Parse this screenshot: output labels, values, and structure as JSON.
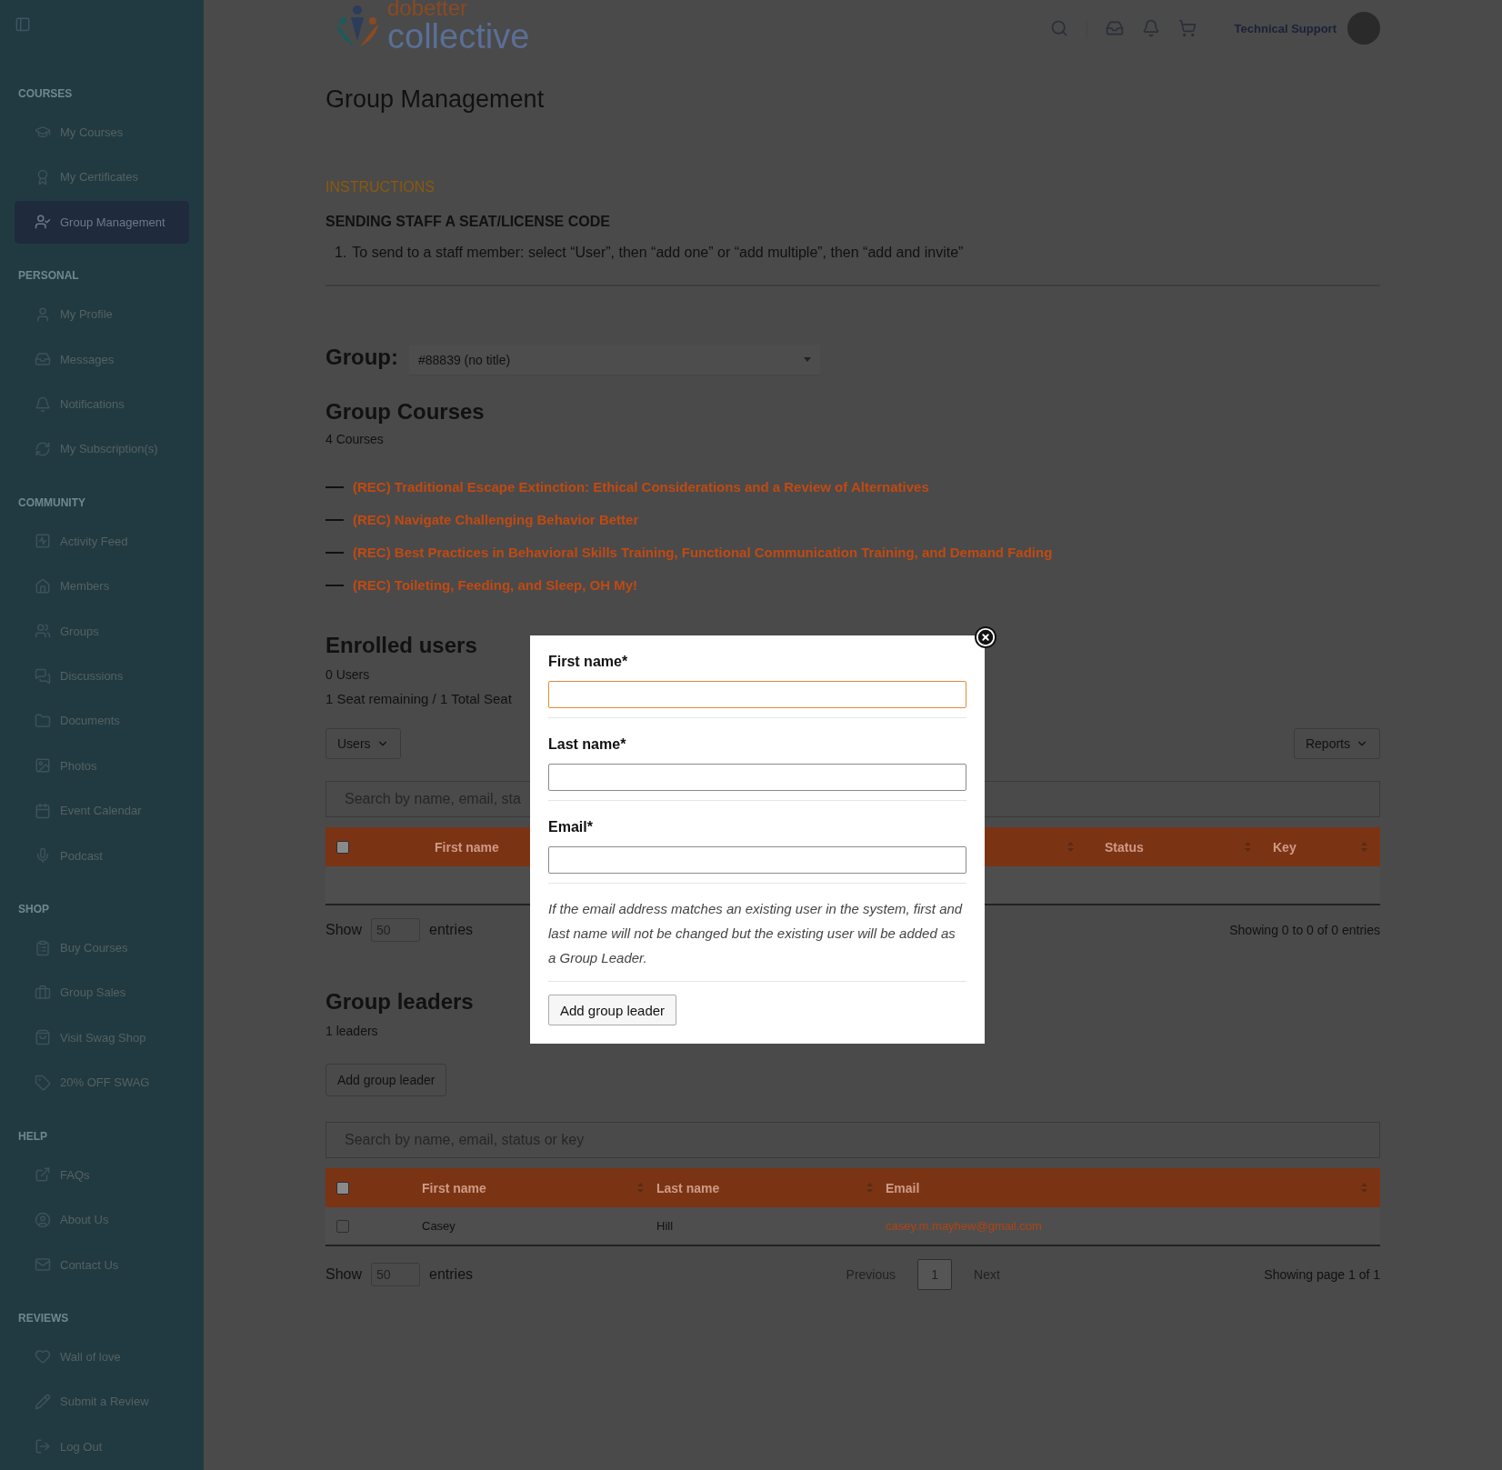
{
  "sidebar": {
    "sections": [
      {
        "heading": "COURSES",
        "items": [
          {
            "label": "My Courses",
            "selected": false
          },
          {
            "label": "My Certificates",
            "selected": false
          },
          {
            "label": "Group Management",
            "selected": true
          }
        ]
      },
      {
        "heading": "PERSONAL",
        "items": [
          {
            "label": "My Profile",
            "selected": false
          },
          {
            "label": "Messages",
            "selected": false
          },
          {
            "label": "Notifications",
            "selected": false
          },
          {
            "label": "My Subscription(s)",
            "selected": false
          }
        ]
      },
      {
        "heading": "COMMUNITY",
        "items": [
          {
            "label": "Activity Feed",
            "selected": false
          },
          {
            "label": "Members",
            "selected": false
          },
          {
            "label": "Groups",
            "selected": false
          },
          {
            "label": "Discussions",
            "selected": false
          },
          {
            "label": "Documents",
            "selected": false
          },
          {
            "label": "Photos",
            "selected": false
          },
          {
            "label": "Event Calendar",
            "selected": false
          },
          {
            "label": "Podcast",
            "selected": false
          }
        ]
      },
      {
        "heading": "SHOP",
        "items": [
          {
            "label": "Buy Courses",
            "selected": false
          },
          {
            "label": "Group Sales",
            "selected": false
          },
          {
            "label": "Visit Swag Shop",
            "selected": false
          },
          {
            "label": "20% OFF SWAG",
            "selected": false
          }
        ]
      },
      {
        "heading": "HELP",
        "items": [
          {
            "label": "FAQs",
            "selected": false
          },
          {
            "label": "About Us",
            "selected": false
          },
          {
            "label": "Contact Us",
            "selected": false
          }
        ]
      },
      {
        "heading": "REVIEWS",
        "items": [
          {
            "label": "Wall of love",
            "selected": false
          },
          {
            "label": "Submit a Review",
            "selected": false
          },
          {
            "label": "Log Out",
            "selected": false
          }
        ]
      }
    ]
  },
  "header": {
    "logo": {
      "top": "dobetter",
      "bottom": "collective"
    },
    "user": "Technical Support"
  },
  "page_title": "Group Management",
  "instructions": {
    "label": "INSTRUCTIONS",
    "heading": "SENDING STAFF A SEAT/LICENSE CODE",
    "steps": [
      {
        "number": "1.",
        "text": "To send to a staff member: select “User”, then “add one” or “add multiple”, then “add and invite”"
      }
    ]
  },
  "group": {
    "label": "Group:",
    "value": "#88839 (no title)"
  },
  "courses": {
    "title": "Group Courses",
    "count": "4 Courses",
    "items": [
      "(REC) Traditional Escape Extinction: Ethical Considerations and a Review of Alternatives",
      "(REC) Navigate Challenging Behavior Better",
      "(REC) Best Practices in Behavioral Skills Training, Functional Communication Training, and Demand Fading",
      "(REC) Toileting, Feeding, and Sleep, OH My!"
    ]
  },
  "enrolled": {
    "title": "Enrolled users",
    "count": "0 Users",
    "seats": "1 Seat remaining / 1 Total Seat",
    "users_menu": "Users",
    "reports_menu": "Reports",
    "search_placeholder": "Search by name, email, sta",
    "select_all_checked": false,
    "columns": [
      "First name",
      "Status",
      "Key"
    ],
    "show": "Show",
    "page_size": "50",
    "entries": "entries",
    "info": "Showing 0 to 0 of 0 entries"
  },
  "leaders": {
    "title": "Group leaders",
    "count": "1 leaders",
    "add_button": "Add group leader",
    "search_placeholder": "Search by name, email, status or key",
    "select_all_checked": false,
    "columns": [
      "First name",
      "Last name",
      "Email"
    ],
    "rows": [
      {
        "first": "Casey",
        "last": "Hill",
        "email": "casey.m.mayhew@gmail.com",
        "checked": false
      }
    ],
    "show": "Show",
    "page_size": "50",
    "entries": "entries",
    "pagination": {
      "previous": "Previous",
      "pages": [
        {
          "label": "1",
          "selected": true
        }
      ],
      "next": "Next"
    },
    "info": "Showing page 1 of 1"
  },
  "modal": {
    "fields": [
      {
        "label": "First name*",
        "focused": true
      },
      {
        "label": "Last name*",
        "focused": false
      },
      {
        "label": "Email*",
        "focused": false
      }
    ],
    "note": "If the email address matches an existing user in the system, first and last name will not be changed but the existing user will be added as a Group Leader.",
    "button": "Add group leader"
  }
}
